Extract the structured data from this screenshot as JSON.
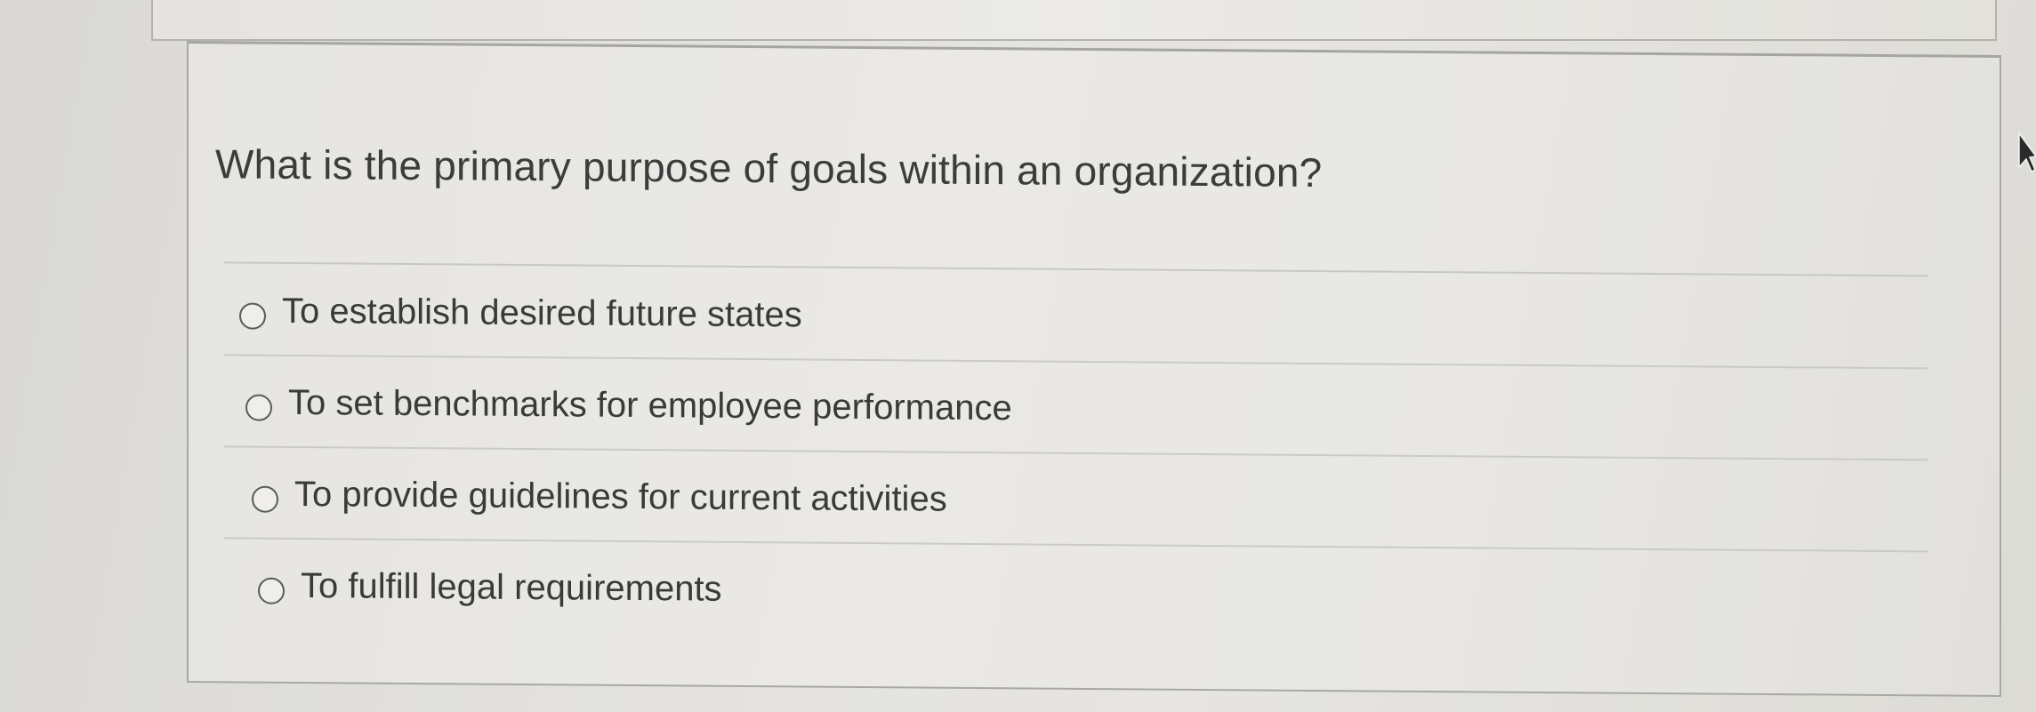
{
  "question": {
    "text": "What is the primary purpose of goals within an organization?"
  },
  "options": [
    {
      "label": "To establish desired future states",
      "selected": false
    },
    {
      "label": "To set benchmarks for employee performance",
      "selected": false
    },
    {
      "label": "To provide guidelines for current activities",
      "selected": false
    },
    {
      "label": "To fulfill legal requirements",
      "selected": false
    }
  ],
  "colors": {
    "text": "#3a3a3a",
    "border": "#a9a8a3",
    "background": "#e6e5e1"
  },
  "icons": {
    "cursor": "mouse-pointer-icon",
    "radio": "radio-empty-icon"
  }
}
